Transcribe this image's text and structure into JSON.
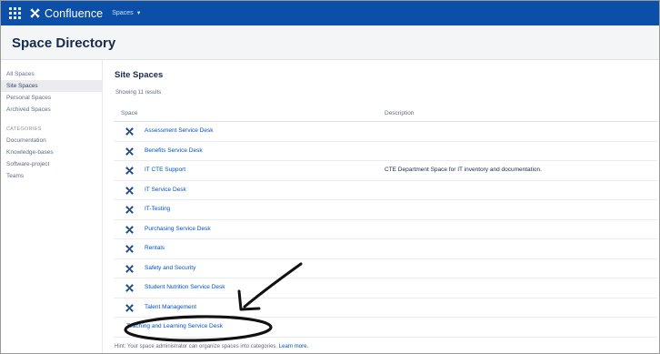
{
  "topnav": {
    "app_name": "Confluence",
    "spaces_menu": "Spaces",
    "brand_color": "#0b4fa8"
  },
  "header": {
    "title": "Space Directory"
  },
  "sidebar": {
    "items": [
      "All Spaces",
      "Site Spaces",
      "Personal Spaces",
      "Archived Spaces"
    ],
    "active_item": "Site Spaces",
    "categories_heading": "CATEGORIES",
    "categories": [
      "Documentation",
      "Knowledge-bases",
      "Software-project",
      "Teams"
    ]
  },
  "main": {
    "title": "Site Spaces",
    "results_count": "Showing 11 results",
    "col_space": "Space",
    "col_description": "Description",
    "link_color": "#0052cc",
    "rows": [
      {
        "name": "Assessment Service Desk",
        "description": "",
        "icon": "confluence-x-icon"
      },
      {
        "name": "Benefits Service Desk",
        "description": "",
        "icon": "confluence-x-icon"
      },
      {
        "name": "IT CTE Support",
        "description": "CTE Department Space for IT inventory and documentation.",
        "icon": "confluence-x-icon"
      },
      {
        "name": "IT Service Desk",
        "description": "",
        "icon": "confluence-x-icon"
      },
      {
        "name": "IT-Testing",
        "description": "",
        "icon": "confluence-x-icon"
      },
      {
        "name": "Purchasing Service Desk",
        "description": "",
        "icon": "confluence-x-icon"
      },
      {
        "name": "Rentals",
        "description": "",
        "icon": "confluence-x-icon"
      },
      {
        "name": "Safety and Security",
        "description": "",
        "icon": "confluence-x-icon"
      },
      {
        "name": "Student Nutrition Service Desk",
        "description": "",
        "icon": "confluence-x-icon"
      },
      {
        "name": "Talent Management",
        "description": "",
        "icon": "confluence-x-icon"
      },
      {
        "name": "Teaching and Learning Service Desk",
        "description": "",
        "icon": ""
      }
    ],
    "hint": "Hint: Your space administrator can organize spaces into categories.",
    "hint_link": "Learn more."
  },
  "annotation": {
    "icon": "hand-drawn-arrow-and-circle"
  }
}
